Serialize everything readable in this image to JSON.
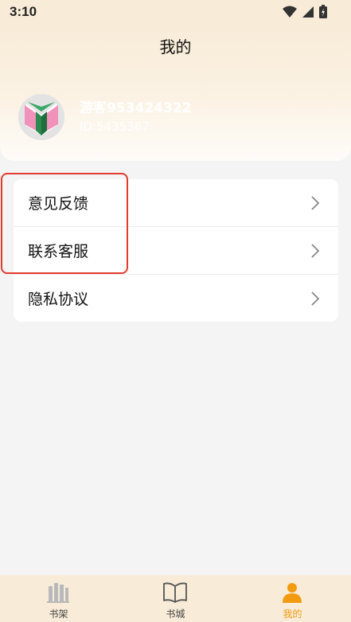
{
  "status_bar": {
    "time": "3:10"
  },
  "header": {
    "title": "我的"
  },
  "user": {
    "name": "游客953424322",
    "id_text": "ID:5435367"
  },
  "menu": {
    "items": [
      {
        "label": "意见反馈"
      },
      {
        "label": "联系客服"
      },
      {
        "label": "隐私协议"
      }
    ]
  },
  "bottom_nav": {
    "tabs": [
      {
        "label": "书架",
        "icon": "bookshelf-icon",
        "active": false
      },
      {
        "label": "书城",
        "icon": "book-open-icon",
        "active": false
      },
      {
        "label": "我的",
        "icon": "person-icon",
        "active": true
      }
    ]
  },
  "colors": {
    "accent": "#f29b11",
    "header_bg": "#f8ecd8",
    "highlight_border": "#e23b2e"
  }
}
